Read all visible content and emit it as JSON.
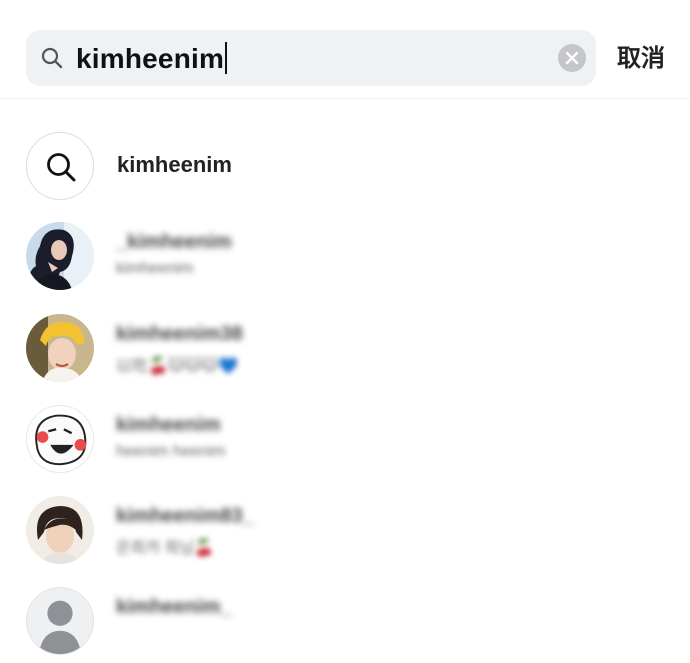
{
  "search": {
    "query": "kimheenim",
    "cancel_label": "取消"
  },
  "suggestion": {
    "label": "kimheenim"
  },
  "results": [
    {
      "name": "_kimheenim",
      "sub": "kimheenim"
    },
    {
      "name": "kimheenim38",
      "sub": "以吃🍒🐱🐱🐱💙"
    },
    {
      "name": "kimheenim",
      "sub": "heenim heenim"
    },
    {
      "name": "kimheenim83_",
      "sub": "은희카 희님🍒"
    },
    {
      "name": "kimheenim_",
      "sub": ""
    }
  ],
  "colors": {
    "search_bg": "#eef2f5",
    "clear_icon": "#c4c6c9",
    "text_primary": "#111111"
  }
}
